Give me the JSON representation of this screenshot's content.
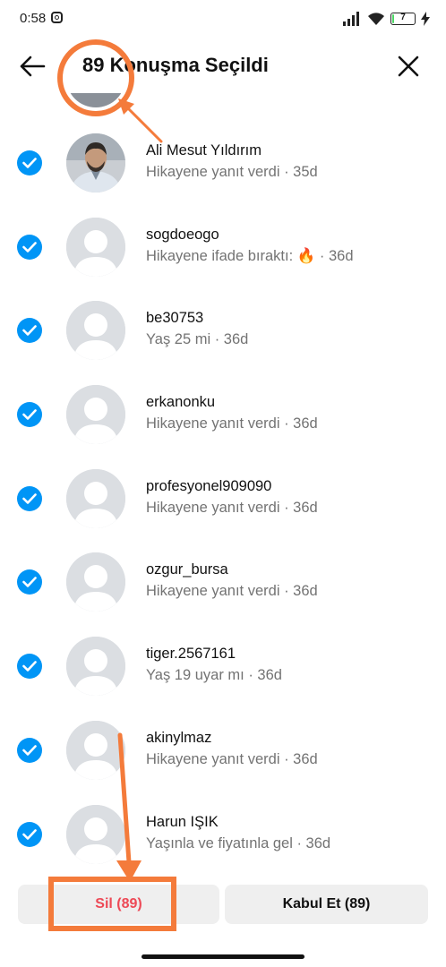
{
  "status_bar": {
    "time": "0:58",
    "battery_level": "7",
    "battery_fraction": 0.07
  },
  "header": {
    "title": "89 Konuşma Seçildi",
    "back_icon": "arrow-left-icon",
    "close_icon": "close-icon"
  },
  "conversations": [
    {
      "name": "Ali Mesut Yıldırım",
      "preview": "Hikayene yanıt verdi · 35d",
      "avatar": "photo",
      "selected": true
    },
    {
      "name": "sogdoeogo",
      "preview": "Hikayene ifade bıraktı: 🔥 · 36d",
      "avatar": "default",
      "selected": true
    },
    {
      "name": "be30753",
      "preview": "Yaş 25 mi · 36d",
      "avatar": "default",
      "selected": true
    },
    {
      "name": "erkanonku",
      "preview": "Hikayene yanıt verdi · 36d",
      "avatar": "default",
      "selected": true
    },
    {
      "name": "profesyonel909090",
      "preview": "Hikayene yanıt verdi · 36d",
      "avatar": "default",
      "selected": true
    },
    {
      "name": "ozgur_bursa",
      "preview": "Hikayene yanıt verdi · 36d",
      "avatar": "default",
      "selected": true
    },
    {
      "name": "tiger.2567161",
      "preview": "Yaş 19 uyar mı · 36d",
      "avatar": "default",
      "selected": true
    },
    {
      "name": "akinylmaz",
      "preview": "Hikayene yanıt verdi · 36d",
      "avatar": "default",
      "selected": true
    },
    {
      "name": "Harun IŞIK",
      "preview": "Yaşınla ve fiyatınla gel · 36d",
      "avatar": "default",
      "selected": true
    }
  ],
  "actions": {
    "delete_label": "Sil (89)",
    "accept_label": "Kabul Et (89)"
  },
  "colors": {
    "accent": "#0095f6",
    "delete_text": "#ed4956",
    "annotation": "#f47b3b",
    "button_bg": "#efefef"
  }
}
